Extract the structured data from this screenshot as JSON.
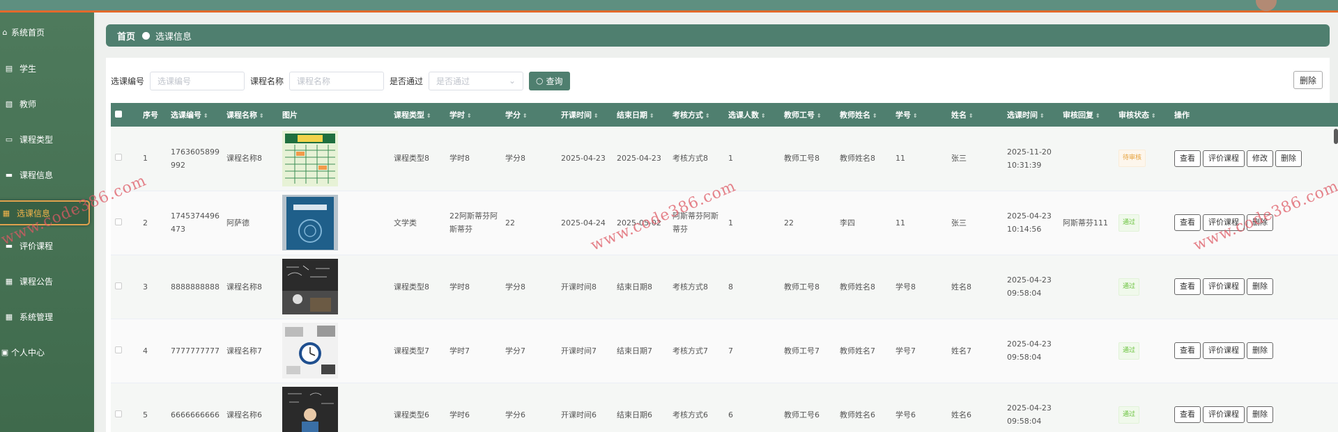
{
  "sidebar": {
    "items": [
      {
        "label": "系统首页",
        "icon": "home-icon"
      },
      {
        "label": "学生",
        "icon": "clipboard-icon"
      },
      {
        "label": "教师",
        "icon": "chart-icon"
      },
      {
        "label": "课程类型",
        "icon": "monitor-icon"
      },
      {
        "label": "课程信息",
        "icon": "message-icon"
      },
      {
        "label": "选课信息",
        "icon": "grid-icon"
      },
      {
        "label": "评价课程",
        "icon": "message-icon"
      },
      {
        "label": "课程公告",
        "icon": "grid-icon"
      },
      {
        "label": "系统管理",
        "icon": "grid-icon"
      },
      {
        "label": "个人中心",
        "icon": "calendar-icon"
      }
    ]
  },
  "breadcrumb": {
    "home": "首页",
    "current": "选课信息"
  },
  "search": {
    "code_label": "选课编号",
    "code_placeholder": "选课编号",
    "course_label": "课程名称",
    "course_placeholder": "课程名称",
    "passed_label": "是否通过",
    "passed_placeholder": "是否通过",
    "query_label": "查询"
  },
  "toolbar": {
    "delete_label": "删除"
  },
  "table": {
    "headers": [
      "序号",
      "选课编号",
      "课程名称",
      "图片",
      "课程类型",
      "学时",
      "学分",
      "开课时间",
      "结束日期",
      "考核方式",
      "选课人数",
      "教师工号",
      "教师姓名",
      "学号",
      "姓名",
      "选课时间",
      "审核回复",
      "审核状态",
      "操作"
    ],
    "rows": [
      {
        "idx": "1",
        "code": "1763605899992",
        "course": "课程名称8",
        "img": "timetable",
        "type": "课程类型8",
        "hours": "学时8",
        "credit": "学分8",
        "start": "2025-04-23",
        "end": "2025-04-23",
        "exam": "考核方式8",
        "count": "1",
        "tid": "教师工号8",
        "tname": "教师姓名8",
        "sid": "11",
        "sname": "张三",
        "time": "2025-11-20 10:31:39",
        "reply": "",
        "status": "待审核",
        "status_kind": "pending",
        "ops": [
          "查看",
          "评价课程",
          "修改",
          "删除"
        ]
      },
      {
        "idx": "2",
        "code": "1745374496473",
        "course": "阿萨德",
        "img": "book",
        "type": "文学类",
        "hours": "22阿斯蒂芬阿斯蒂芬",
        "credit": "22",
        "start": "2025-04-24",
        "end": "2025-05-02",
        "exam": "阿斯蒂芬阿斯蒂芬",
        "count": "1",
        "tid": "22",
        "tname": "李四",
        "sid": "11",
        "sname": "张三",
        "time": "2025-04-23 10:14:56",
        "reply": "阿斯蒂芬111",
        "status": "通过",
        "status_kind": "ok",
        "ops": [
          "查看",
          "评价课程",
          "删除"
        ]
      },
      {
        "idx": "3",
        "code": "8888888888",
        "course": "课程名称8",
        "img": "blackboard",
        "type": "课程类型8",
        "hours": "学时8",
        "credit": "学分8",
        "start": "开课时间8",
        "end": "结束日期8",
        "exam": "考核方式8",
        "count": "8",
        "tid": "教师工号8",
        "tname": "教师姓名8",
        "sid": "学号8",
        "sname": "姓名8",
        "time": "2025-04-23 09:58:04",
        "reply": "",
        "status": "通过",
        "status_kind": "ok",
        "ops": [
          "查看",
          "评价课程",
          "删除"
        ]
      },
      {
        "idx": "4",
        "code": "7777777777",
        "course": "课程名称7",
        "img": "clock",
        "type": "课程类型7",
        "hours": "学时7",
        "credit": "学分7",
        "start": "开课时间7",
        "end": "结束日期7",
        "exam": "考核方式7",
        "count": "7",
        "tid": "教师工号7",
        "tname": "教师姓名7",
        "sid": "学号7",
        "sname": "姓名7",
        "time": "2025-04-23 09:58:04",
        "reply": "",
        "status": "通过",
        "status_kind": "ok",
        "ops": [
          "查看",
          "评价课程",
          "删除"
        ]
      },
      {
        "idx": "5",
        "code": "6666666666",
        "course": "课程名称6",
        "img": "child",
        "type": "课程类型6",
        "hours": "学时6",
        "credit": "学分6",
        "start": "开课时间6",
        "end": "结束日期6",
        "exam": "考核方式6",
        "count": "6",
        "tid": "教师工号6",
        "tname": "教师姓名6",
        "sid": "学号6",
        "sname": "姓名6",
        "time": "2025-04-23 09:58:04",
        "reply": "",
        "status": "通过",
        "status_kind": "ok",
        "ops": [
          "查看",
          "评价课程",
          "删除"
        ]
      }
    ]
  },
  "watermark": {
    "text": "www.code386.com"
  },
  "colors": {
    "primary": "#4f7f6f",
    "sidebar": "#4e7a5c",
    "accent": "#e26a2c",
    "active": "#f2b44a"
  }
}
